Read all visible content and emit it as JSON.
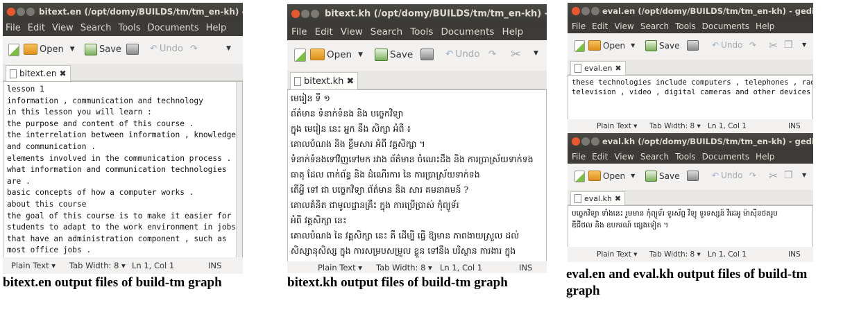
{
  "menu": [
    "File",
    "Edit",
    "View",
    "Search",
    "Tools",
    "Documents",
    "Help"
  ],
  "toolbar": {
    "open": "Open",
    "save": "Save",
    "undo": "Undo"
  },
  "status": {
    "plain": "Plain Text ▾",
    "tab": "Tab Width: 8 ▾",
    "pos": "Ln 1, Col 1",
    "mode": "INS"
  },
  "win1": {
    "title": "bitext.en (/opt/domy/BUILDS/tm/tm_en-kh) - gedit",
    "tab": "bitext.en",
    "lines": [
      " lesson 1",
      "information , communication and technology",
      "in this lesson you will learn :",
      "the purpose and content of this course .",
      "the interrelation between information , knowledge",
      "and communication .",
      "elements involved in the communication process .",
      "what information and communication technologies",
      "are .",
      "basic concepts of how a computer works .",
      "about this course",
      "the goal of this course is to make it easier for",
      "students to adapt to the work environment in jobs",
      "that have an administration component , such as",
      "most office jobs ."
    ]
  },
  "win2": {
    "title": "bitext.kh (/opt/domy/BUILDS/tm/tm_en-kh) - gedit",
    "tab": "bitext.kh",
    "lines": [
      "មេរៀន ទី ១",
      "ព័ត៌មាន ទំនាក់ទំនង និង បច្ចេកវិទ្យា",
      "ក្នុង មេរៀន នេះ អ្នក នឹង សិក្សា អំពី ៖",
      "គោលបំណង និង ខ្លឹមសារ អំពី វគ្គសិក្សា ។",
      "ទំនាក់ទំនងទៅវិញទៅមក រវាង ព័ត៌មាន ចំណេះដឹង និង ការប្រាស្រ័យទាក់ទង",
      "ធាតុ ដែល ពាក់ព័ន្ធ និង ដំណើរការ នៃ ការប្រាស្រ័យទាក់ទង",
      "តើអ្វី ទៅ ជា បច្ចេកវិទ្យា ព័ត៌មាន និង សារ គមនាគមន៍ ?",
      "គោលគំនិត ជាមូលដ្ឋានគ្រឹះ ក្នុង ការប្រើប្រាស់ កុំព្យូទ័រ",
      "អំពី វគ្គសិក្សា នេះ",
      "គោលបំណង នៃ វគ្គសិក្សា នេះ គឺ ដើម្បី ធ្វើ ឱ្យមាន ភាពងាយស្រួល ដល់",
      "សិស្សានុសិស្ស ក្នុង ការសម្របសម្រួល ខ្លួន ទៅនឹង បរិស្ថាន ការងារ ក្នុង"
    ]
  },
  "win3": {
    "title": "eval.en (/opt/domy/BUILDS/tm/tm_en-kh) - gedit",
    "tab": "eval.en",
    "lines": [
      "these technologies include computers , telephones , radio ,",
      "television , video , digital cameras and other devices ."
    ]
  },
  "win4": {
    "title": "eval.kh (/opt/domy/BUILDS/tm/tm_en-kh) - gedit",
    "tab": "eval.kh",
    "lines": [
      "បច្ចេកវិទ្យា ទាំងនេះ រួមមាន កុំព្យូទ័រ ទូរស័ព្ទ វិទ្យុ ទូរទស្សន៍ វីដេអូ ម៉ាស៊ីនថតរូប",
      "ឌីជីថល និង ឧបករណ៍ ផ្សេងទៀត ។"
    ]
  },
  "captions": {
    "c1": "bitext.en output files of build-tm graph",
    "c2": "bitext.kh output files of build-tm graph",
    "c3": "eval.en and eval.kh output files of build-tm graph"
  }
}
